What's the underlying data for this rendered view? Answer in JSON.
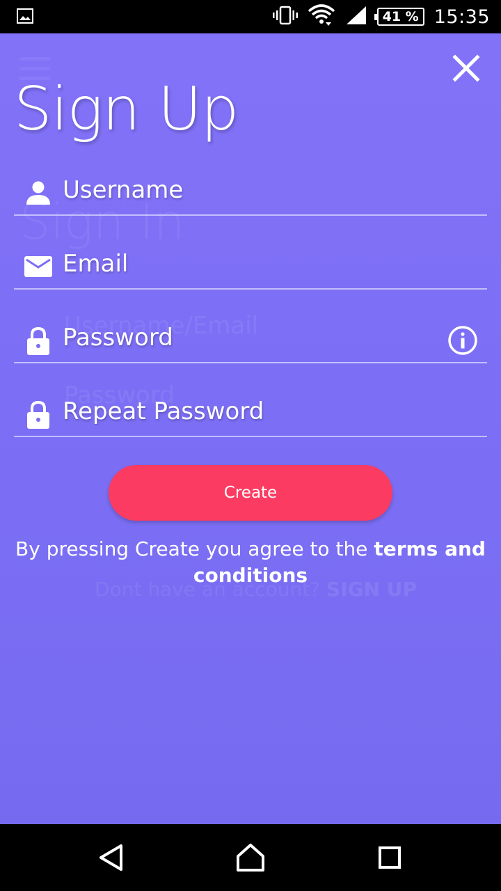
{
  "status_bar": {
    "battery": "41 %",
    "time": "15:35",
    "icons": [
      "image-notification-icon",
      "vibrate-icon",
      "wifi-icon",
      "signal-icon",
      "battery-icon"
    ]
  },
  "form": {
    "title": "Sign Up",
    "username_placeholder": "Username",
    "email_placeholder": "Email",
    "password_placeholder": "Password",
    "repeat_password_placeholder": "Repeat Password",
    "create_label": "Create",
    "terms_prefix": "By pressing Create you agree to the ",
    "terms_link": "terms and conditions"
  },
  "background_screen": {
    "title": "Sign In",
    "username_email": "Username/Email",
    "password": "Password",
    "no_account_text": "Dont have an account?",
    "sign_up_link": "SIGN UP"
  },
  "colors": {
    "background": "#7b6ef4",
    "button": "#fb3b62",
    "text": "#ffffff"
  }
}
